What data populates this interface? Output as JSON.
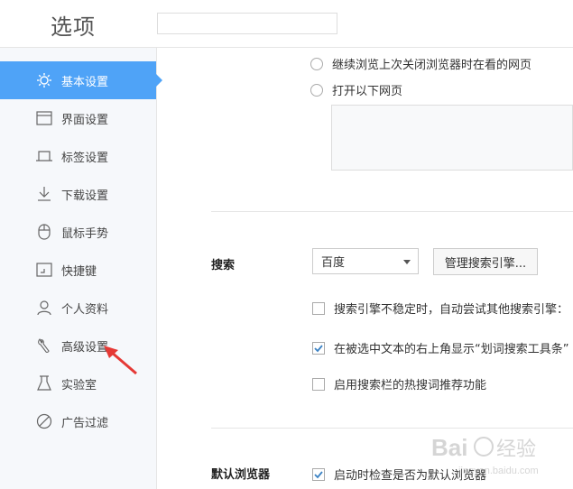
{
  "header": {
    "title": "选项",
    "search_placeholder": ""
  },
  "sidebar": {
    "items": [
      {
        "label": "基本设置",
        "icon": "sun-gear-icon",
        "active": true
      },
      {
        "label": "界面设置",
        "icon": "window-icon"
      },
      {
        "label": "标签设置",
        "icon": "tab-icon"
      },
      {
        "label": "下载设置",
        "icon": "download-icon"
      },
      {
        "label": "鼠标手势",
        "icon": "mouse-icon"
      },
      {
        "label": "快捷键",
        "icon": "shortcut-icon"
      },
      {
        "label": "个人资料",
        "icon": "person-icon"
      },
      {
        "label": "高级设置",
        "icon": "wrench-icon"
      },
      {
        "label": "实验室",
        "icon": "flask-icon"
      },
      {
        "label": "广告过滤",
        "icon": "block-icon"
      }
    ]
  },
  "startup": {
    "option_continue": "继续浏览上次关闭浏览器时在看的网页",
    "option_open_pages": "打开以下网页"
  },
  "search": {
    "label": "搜索",
    "engine_selected": "百度",
    "manage_button": "管理搜索引擎...",
    "opt_retry": {
      "text": "搜索引擎不稳定时，自动尝试其他搜索引擎：",
      "checked": false
    },
    "opt_toolbar": {
      "text": "在被选中文本的右上角显示“划词搜索工具条”",
      "checked": true
    },
    "opt_hot": {
      "text": "启用搜索栏的热搜词推荐功能",
      "checked": false
    }
  },
  "default_browser": {
    "label": "默认浏览器",
    "opt_check": {
      "text": "启动时检查是否为默认浏览器",
      "checked": true
    }
  },
  "colors": {
    "accent": "#4fa3f7",
    "annotation_arrow": "#e53935"
  },
  "watermark": {
    "text": "Bai经验",
    "sub": "jingyan.baidu.com"
  }
}
